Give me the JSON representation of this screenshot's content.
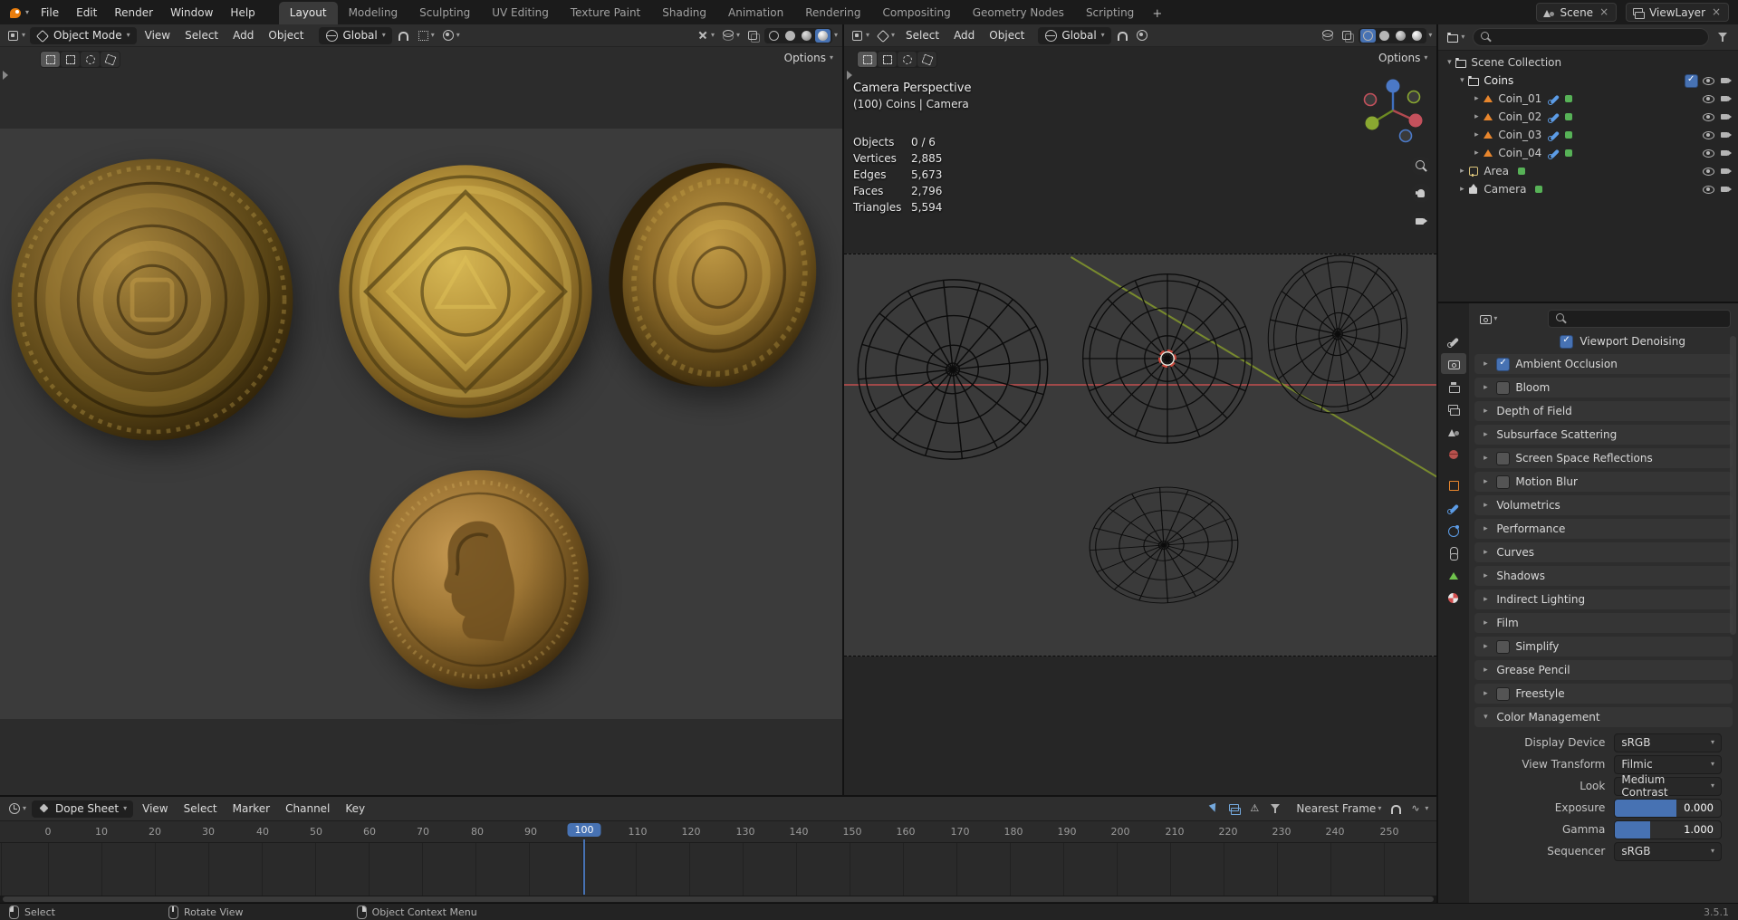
{
  "palette": {
    "accent_blue": "#4772b3",
    "object_orange": "#e87d0d",
    "topbar_bg": "#1b1b1b",
    "header_bg": "#2e2e2e",
    "viewport_bg": "#3b3b3b",
    "panel_bg": "#2d2d2d",
    "coin_gold": "#b08d3e"
  },
  "topbar": {
    "app_menus": [
      {
        "label": "File"
      },
      {
        "label": "Edit"
      },
      {
        "label": "Render"
      },
      {
        "label": "Window"
      },
      {
        "label": "Help"
      }
    ],
    "workspace_tabs": [
      {
        "label": "Layout",
        "active": true
      },
      {
        "label": "Modeling",
        "active": false
      },
      {
        "label": "Sculpting",
        "active": false
      },
      {
        "label": "UV Editing",
        "active": false
      },
      {
        "label": "Texture Paint",
        "active": false
      },
      {
        "label": "Shading",
        "active": false
      },
      {
        "label": "Animation",
        "active": false
      },
      {
        "label": "Rendering",
        "active": false
      },
      {
        "label": "Compositing",
        "active": false
      },
      {
        "label": "Geometry Nodes",
        "active": false
      },
      {
        "label": "Scripting",
        "active": false
      }
    ],
    "add_workspace_label": "+",
    "scene_selector": {
      "value": "Scene"
    },
    "view_layer_selector": {
      "value": "ViewLayer"
    }
  },
  "viewport_main": {
    "mode_selector": {
      "value": "Object Mode"
    },
    "menus": [
      {
        "label": "View"
      },
      {
        "label": "Select"
      },
      {
        "label": "Add"
      },
      {
        "label": "Object"
      }
    ],
    "orientation": {
      "value": "Global"
    },
    "options_label": "Options"
  },
  "viewport_camera": {
    "menus": [
      {
        "label": "Select"
      },
      {
        "label": "Add"
      },
      {
        "label": "Object"
      }
    ],
    "orientation": {
      "value": "Global"
    },
    "options_label": "Options",
    "overlay": {
      "view_label": "Camera Perspective",
      "context_label": "(100) Coins | Camera",
      "stats": [
        {
          "label": "Objects",
          "value": "0 / 6"
        },
        {
          "label": "Vertices",
          "value": "2,885"
        },
        {
          "label": "Edges",
          "value": "5,673"
        },
        {
          "label": "Faces",
          "value": "2,796"
        },
        {
          "label": "Triangles",
          "value": "5,594"
        }
      ]
    }
  },
  "outliner": {
    "search_value": "",
    "rows": [
      {
        "label": "Scene Collection"
      },
      {
        "label": "Coins"
      },
      {
        "label": "Coin_01"
      },
      {
        "label": "Coin_02"
      },
      {
        "label": "Coin_03"
      },
      {
        "label": "Coin_04"
      },
      {
        "label": "Area"
      },
      {
        "label": "Camera"
      }
    ]
  },
  "properties": {
    "search_value": "",
    "viewport_denoising_label": "Viewport Denoising",
    "sections": [
      {
        "label": "Ambient Occlusion",
        "checkbox": true,
        "checked": true
      },
      {
        "label": "Bloom",
        "checkbox": true,
        "checked": false
      },
      {
        "label": "Depth of Field",
        "checkbox": false
      },
      {
        "label": "Subsurface Scattering",
        "checkbox": false
      },
      {
        "label": "Screen Space Reflections",
        "checkbox": true,
        "checked": false
      },
      {
        "label": "Motion Blur",
        "checkbox": true,
        "checked": false
      },
      {
        "label": "Volumetrics",
        "checkbox": false
      },
      {
        "label": "Performance",
        "checkbox": false
      },
      {
        "label": "Curves",
        "checkbox": false
      },
      {
        "label": "Shadows",
        "checkbox": false
      },
      {
        "label": "Indirect Lighting",
        "checkbox": false
      },
      {
        "label": "Film",
        "checkbox": false
      },
      {
        "label": "Simplify",
        "checkbox": true,
        "checked": false
      },
      {
        "label": "Grease Pencil",
        "checkbox": false
      },
      {
        "label": "Freestyle",
        "checkbox": true,
        "checked": false
      }
    ],
    "color_management": {
      "label": "Color Management",
      "display_device": {
        "label": "Display Device",
        "value": "sRGB"
      },
      "view_transform": {
        "label": "View Transform",
        "value": "Filmic"
      },
      "look": {
        "label": "Look",
        "value": "Medium Contrast"
      },
      "exposure": {
        "label": "Exposure",
        "value": "0.000",
        "fill_pct": 58
      },
      "gamma": {
        "label": "Gamma",
        "value": "1.000",
        "fill_pct": 33
      },
      "sequencer": {
        "label": "Sequencer",
        "value": "sRGB"
      }
    }
  },
  "timeline": {
    "editor_selector": {
      "value": "Dope Sheet"
    },
    "menus": [
      {
        "label": "View"
      },
      {
        "label": "Select"
      },
      {
        "label": "Marker"
      },
      {
        "label": "Channel"
      },
      {
        "label": "Key"
      }
    ],
    "snap_selector": {
      "value": "Nearest Frame"
    },
    "current_frame": "100",
    "ticks": [
      "0",
      "10",
      "20",
      "30",
      "40",
      "50",
      "60",
      "70",
      "80",
      "90",
      "100",
      "110",
      "120",
      "130",
      "140",
      "150",
      "160",
      "170",
      "180",
      "190",
      "200",
      "210",
      "220",
      "230",
      "240",
      "250"
    ]
  },
  "statusbar": {
    "hints": [
      {
        "label": "Select"
      },
      {
        "label": "Rotate View"
      },
      {
        "label": "Object Context Menu"
      }
    ],
    "version": "3.5.1"
  }
}
